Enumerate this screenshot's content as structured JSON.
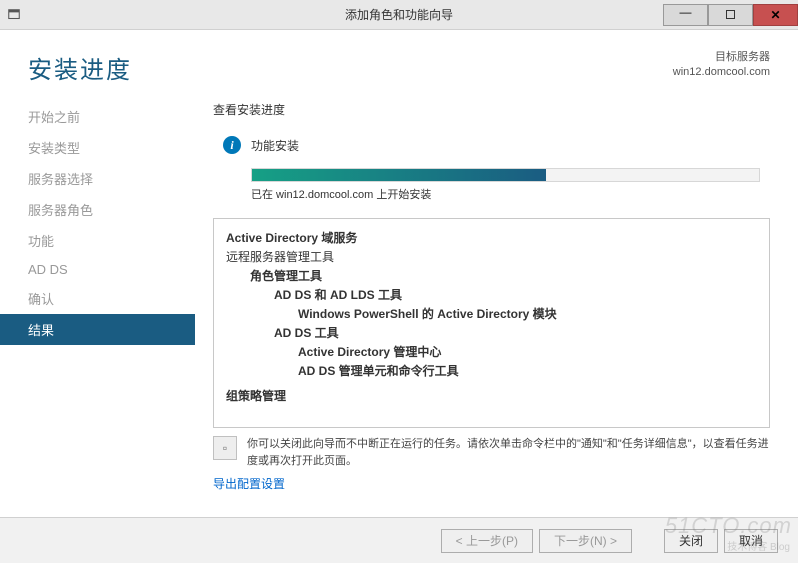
{
  "titlebar": {
    "title": "添加角色和功能向导"
  },
  "header": {
    "heading": "安装进度",
    "target_label": "目标服务器",
    "target_server": "win12.domcool.com"
  },
  "sidebar": {
    "steps": [
      "开始之前",
      "安装类型",
      "服务器选择",
      "服务器角色",
      "功能",
      "AD DS",
      "确认",
      "结果"
    ],
    "active_index": 7
  },
  "content": {
    "subtitle": "查看安装进度",
    "status_text": "功能安装",
    "progress_caption": "已在 win12.domcool.com 上开始安装",
    "details": {
      "l0": "Active Directory 域服务",
      "l1": "远程服务器管理工具",
      "l2": "角色管理工具",
      "l3": "AD DS 和 AD LDS 工具",
      "l4a": "Windows PowerShell 的 Active Directory 模块",
      "l4b": "AD DS 工具",
      "l5a": "Active Directory 管理中心",
      "l5b": "AD DS 管理单元和命令行工具",
      "l6": "组策略管理"
    },
    "note": "你可以关闭此向导而不中断正在运行的任务。请依次单击命令栏中的\"通知\"和\"任务详细信息\"，以查看任务进度或再次打开此页面。",
    "export_link": "导出配置设置"
  },
  "footer": {
    "prev": "< 上一步(P)",
    "next": "下一步(N) >",
    "close": "关闭",
    "cancel": "取消"
  },
  "watermark": {
    "big": "51CTO.com",
    "small": "技术博客  Blog"
  }
}
